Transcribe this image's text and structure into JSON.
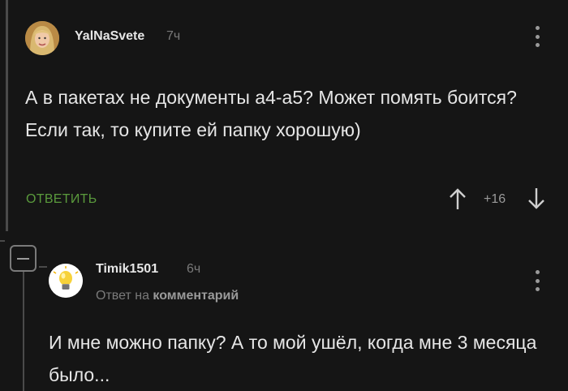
{
  "comment1": {
    "username": "YalNaSvete",
    "time": "7ч",
    "text": "А в пакетах не документы а4-а5? Может помять боится? Если так, то купите ей папку хорошую)",
    "reply_label": "ОТВЕТИТЬ",
    "rating": "+16"
  },
  "comment2": {
    "username": "Timik1501",
    "time": "6ч",
    "reply_prefix": "Ответ на",
    "reply_target": "комментарий",
    "text": "И мне можно папку? А то мой ушёл, когда мне 3 месяца было..."
  },
  "colors": {
    "background": "#151515",
    "reply_link": "#5a9a3c",
    "muted": "#7a7a7a"
  },
  "icons": {
    "menu": "kebab-icon",
    "upvote": "arrow-up-icon",
    "downvote": "arrow-down-icon",
    "collapse": "minus-icon"
  }
}
